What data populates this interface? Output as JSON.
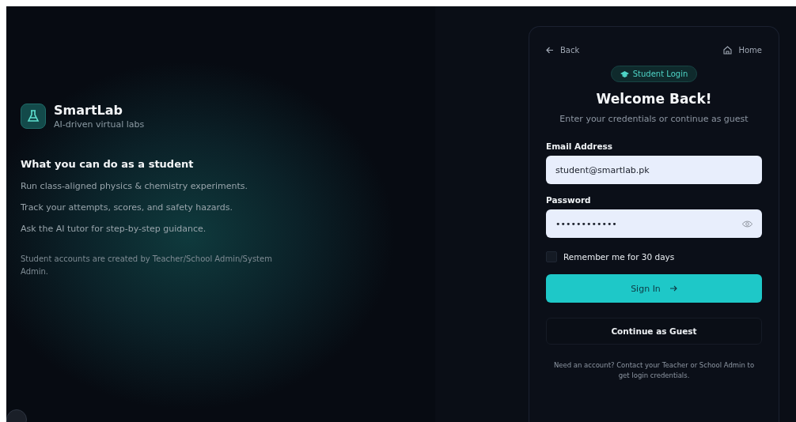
{
  "brand": {
    "name": "SmartLab",
    "tagline": "AI-driven virtual labs"
  },
  "features": {
    "heading": "What you can do as a student",
    "items": [
      "Run class-aligned physics & chemistry experiments.",
      "Track your attempts, scores, and safety hazards.",
      "Ask the AI tutor for step-by-step guidance."
    ],
    "note": "Student accounts are created by Teacher/School Admin/System Admin."
  },
  "nav": {
    "back": "Back",
    "home": "Home"
  },
  "badge": "Student Login",
  "title": "Welcome Back!",
  "subtitle": "Enter your credentials or continue as guest",
  "fields": [
    {
      "label": "Email Address",
      "value": "student@smartlab.pk",
      "kind": "text"
    },
    {
      "label": "Password",
      "value": "••••••••••••",
      "kind": "password"
    }
  ],
  "remember": {
    "label": "Remember me for 30 days",
    "checked": false
  },
  "buttons": {
    "primary": "Sign In",
    "secondary": "Continue as Guest"
  },
  "footer": "Need an account? Contact your Teacher or School Admin to get login credentials."
}
